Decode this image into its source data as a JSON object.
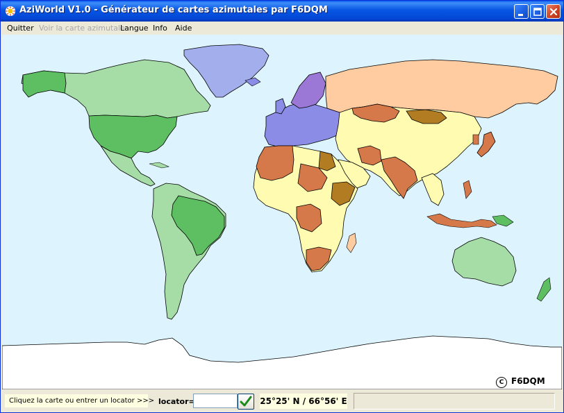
{
  "window": {
    "title": "AziWorld V1.0 - Générateur de cartes azimutales par F6DQM"
  },
  "menu": [
    {
      "label": "Quitter",
      "enabled": true
    },
    {
      "label": "Voir la carte azimutale",
      "enabled": false
    },
    {
      "label": "Langue",
      "enabled": true
    },
    {
      "label": "Info",
      "enabled": true
    },
    {
      "label": "Aide",
      "enabled": true
    }
  ],
  "map": {
    "copyright_symbol": "C",
    "copyright_text": "F6DQM",
    "ocean_color": "#DDF4FE",
    "region_colors": {
      "north_america": "#5DBE62",
      "canada": "#A6DDA6",
      "south_america": "#5DBE62",
      "greenland": "#A3AEEC",
      "europe": "#8A8CE6",
      "scandinavia": "#9C78D6",
      "russia": "#FFCBA0",
      "africa_dark": "#D5794A",
      "africa_light": "#FFFBB0",
      "africa_mid": "#B27C22",
      "asia": "#FFFBB0",
      "australia": "#A6DDA6"
    }
  },
  "status": {
    "hint": "Cliquez la carte ou entrer un locator >>>",
    "locator_label": "locator=",
    "locator_value": "",
    "coordinates": "25°25' N / 66°56' E"
  }
}
